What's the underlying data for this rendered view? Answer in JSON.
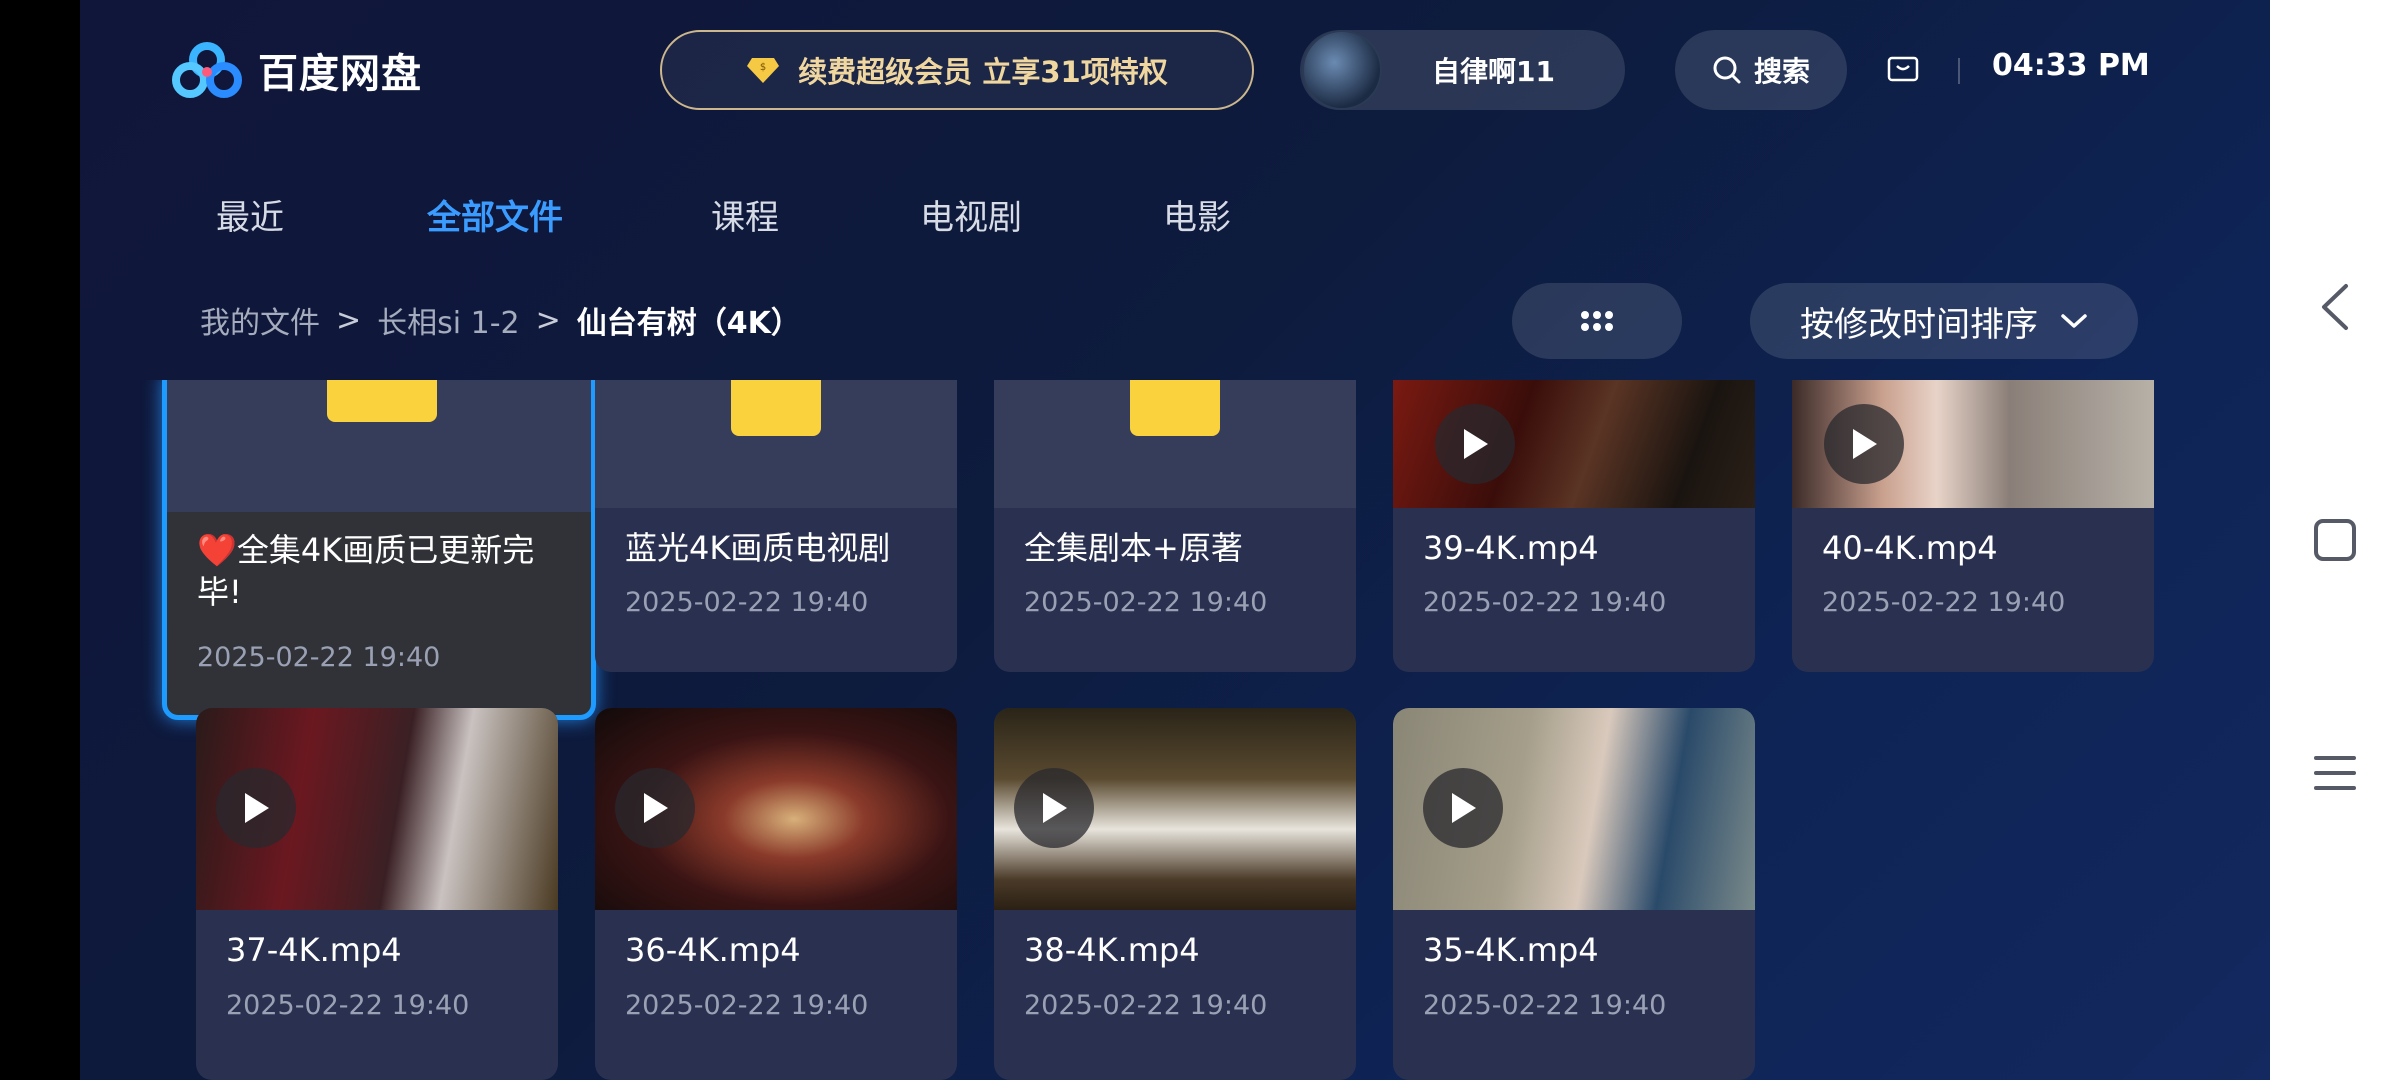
{
  "header": {
    "brand": "百度网盘",
    "promo_text": "续费超级会员 立享31项特权",
    "user_name": "自律啊11",
    "search_label": "搜索",
    "clock": "04:33 PM"
  },
  "tabs": [
    {
      "label": "最近",
      "active": false
    },
    {
      "label": "全部文件",
      "active": true
    },
    {
      "label": "课程",
      "active": false
    },
    {
      "label": "电视剧",
      "active": false
    },
    {
      "label": "电影",
      "active": false
    }
  ],
  "breadcrumb": {
    "items": [
      "我的文件",
      "长相si 1-2",
      "仙台有树（4K）"
    ],
    "separator": ">"
  },
  "sort": {
    "label": "按修改时间排序"
  },
  "files": [
    {
      "type": "folder",
      "name": "❤️全集4K画质已更新完毕!",
      "date": "2025-02-22  19:40",
      "focused": true
    },
    {
      "type": "folder",
      "name": "蓝光4K画质电视剧",
      "date": "2025-02-22  19:40"
    },
    {
      "type": "folder",
      "name": "全集剧本+原著",
      "date": "2025-02-22  19:40"
    },
    {
      "type": "video",
      "name": "39-4K.mp4",
      "date": "2025-02-22  19:40"
    },
    {
      "type": "video",
      "name": "40-4K.mp4",
      "date": "2025-02-22  19:40"
    },
    {
      "type": "video",
      "name": "37-4K.mp4",
      "date": "2025-02-22  19:40"
    },
    {
      "type": "video",
      "name": "36-4K.mp4",
      "date": "2025-02-22  19:40"
    },
    {
      "type": "video",
      "name": "38-4K.mp4",
      "date": "2025-02-22  19:40"
    },
    {
      "type": "video",
      "name": "35-4K.mp4",
      "date": "2025-02-22  19:40"
    }
  ],
  "icons": {
    "logo": "baidu-netdisk-logo-icon",
    "promo": "diamond-icon",
    "search": "search-icon",
    "cast": "tv-cast-icon",
    "grid": "grid-dots-icon",
    "sort": "chevron-down-icon",
    "play": "play-icon",
    "nav_back": "back-icon",
    "nav_home": "home-icon",
    "nav_menu": "menu-icon"
  },
  "colors": {
    "accent": "#3b9cff",
    "folder": "#f9d23d",
    "promo_gold": "#f0d7a0"
  }
}
